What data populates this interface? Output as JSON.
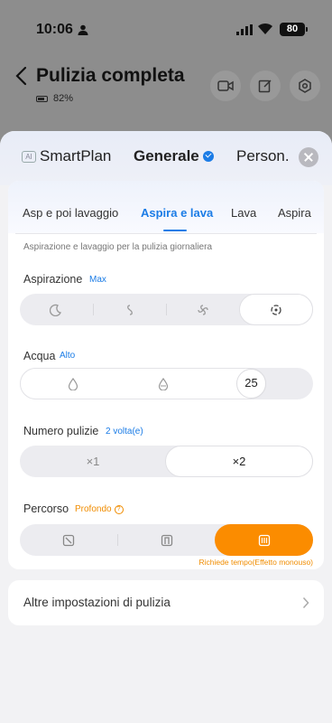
{
  "status_bar": {
    "time": "10:06",
    "battery": "80"
  },
  "header": {
    "title": "Pulizia completa",
    "battery_level": "82%"
  },
  "mode_tabs": [
    {
      "label": "SmartPlan",
      "badge": "AI"
    },
    {
      "label": "Generale"
    },
    {
      "label": "Person."
    }
  ],
  "sub_tabs": [
    "Asp e poi lavaggio",
    "Aspira e lava",
    "Lava",
    "Aspira"
  ],
  "description": "Aspirazione e lavaggio per la pulizia giornaliera",
  "suction": {
    "label": "Aspirazione",
    "value": "Max",
    "selected_index": 3,
    "levels": 4
  },
  "water": {
    "label": "Acqua",
    "value": "Alto",
    "slider_value": "25"
  },
  "passes": {
    "label": "Numero pulizie",
    "value": "2 volta(e)",
    "options": [
      "×1",
      "×2"
    ],
    "selected_index": 1
  },
  "route": {
    "label": "Percorso",
    "value": "Profondo",
    "help": "?",
    "note": "Richiede tempo(Effetto monouso)",
    "selected_index": 2
  },
  "more_settings": {
    "label": "Altre impostazioni di pulizia"
  },
  "colors": {
    "accent_blue": "#1b7ce6",
    "accent_orange": "#fb8c00"
  }
}
